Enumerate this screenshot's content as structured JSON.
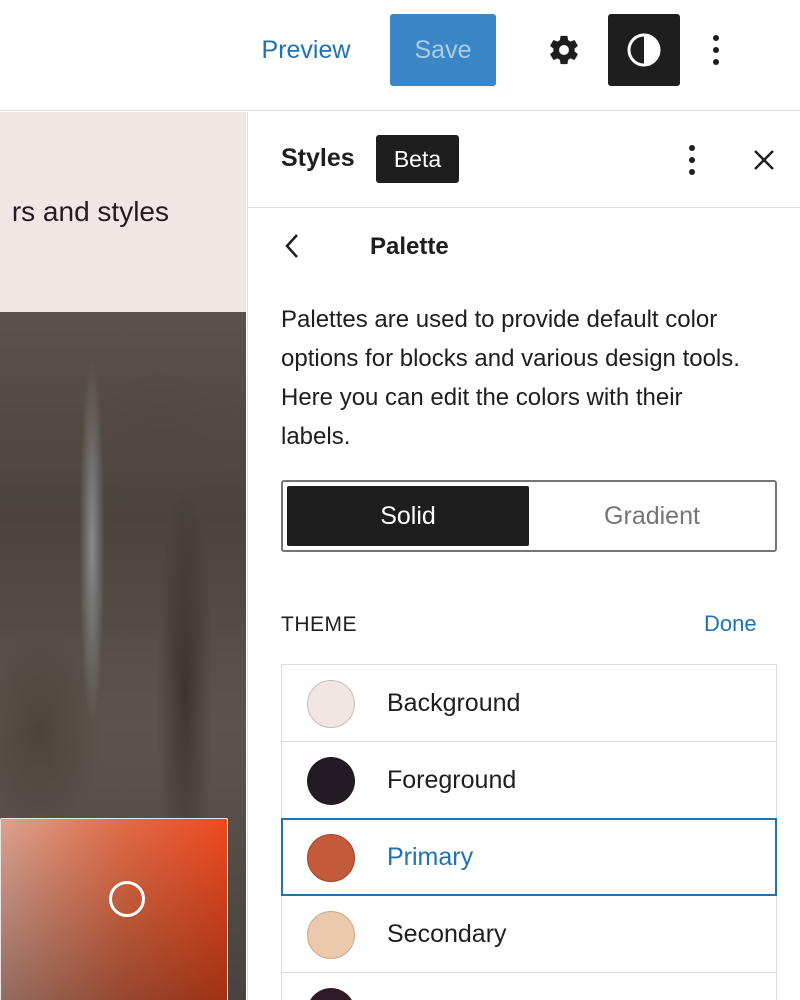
{
  "toolbar": {
    "preview_label": "Preview",
    "save_label": "Save"
  },
  "canvas": {
    "heading_fragment": "rs and styles"
  },
  "panel": {
    "title": "Styles",
    "badge": "Beta"
  },
  "palette_screen": {
    "title": "Palette",
    "description": "Palettes are used to provide default color options for blocks and various design tools. Here you can edit the colors with their labels.",
    "tabs": [
      {
        "label": "Solid",
        "selected": true
      },
      {
        "label": "Gradient",
        "selected": false
      }
    ],
    "section_label": "THEME",
    "done_label": "Done",
    "colors": [
      {
        "name": "Background",
        "color": "#f1e6e3",
        "active": false
      },
      {
        "name": "Foreground",
        "color": "#231b23",
        "active": false
      },
      {
        "name": "Primary",
        "color": "#c45a3a",
        "active": true
      },
      {
        "name": "Secondary",
        "color": "#ebc9ac",
        "active": false
      },
      {
        "name": "",
        "color": "#2f1b27",
        "active": false
      }
    ]
  },
  "icons": {
    "settings": "gear-icon",
    "style_toggle": "half-circle-contrast-icon",
    "options": "vertical-ellipsis-icon",
    "close": "close-icon",
    "back": "chevron-left-icon"
  },
  "theme_colors": {
    "accent": "#2271b1",
    "save_button": "#3a86c6",
    "dark": "#1e1e1e"
  }
}
